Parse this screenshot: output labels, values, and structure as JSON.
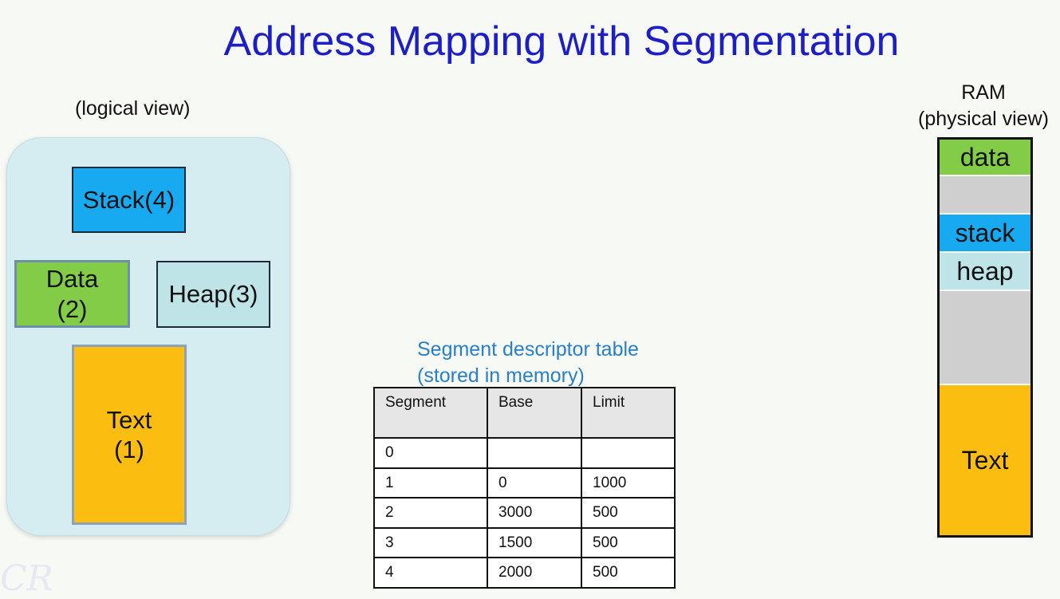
{
  "title": "Address Mapping with Segmentation",
  "logical": {
    "caption": "(logical view)",
    "segments": {
      "stack": "Stack(4)",
      "data_line1": "Data",
      "data_line2": "(2)",
      "heap": "Heap(3)",
      "text_line1": "Text",
      "text_line2": "(1)"
    }
  },
  "table": {
    "caption_line1": "Segment descriptor table",
    "caption_line2": "(stored in memory)",
    "headers": [
      "Segment",
      "Base",
      "Limit"
    ],
    "rows": [
      [
        "0",
        "",
        ""
      ],
      [
        "1",
        "0",
        "1000"
      ],
      [
        "2",
        "3000",
        "500"
      ],
      [
        "3",
        "1500",
        "500"
      ],
      [
        "4",
        "2000",
        "500"
      ]
    ]
  },
  "ram": {
    "caption_line1": "RAM",
    "caption_line2": "(physical view)",
    "blocks": [
      {
        "label": "data",
        "color": "#82cc47",
        "weight": 46
      },
      {
        "label": "",
        "color": "#cfcfcf",
        "weight": 48
      },
      {
        "label": "stack",
        "color": "#17aaf0",
        "weight": 48
      },
      {
        "label": "heap",
        "color": "#bfe4e8",
        "weight": 48
      },
      {
        "label": "",
        "color": "#cfcfcf",
        "weight": 118
      },
      {
        "label": "Text",
        "color": "#fbbd0f",
        "weight": 188
      }
    ]
  },
  "colors": {
    "title": "#1d1fc4",
    "caption_blue": "#2a7fc6",
    "stack": "#17aaf0",
    "data": "#82cc47",
    "heap": "#bfe4e8",
    "text": "#fbbd0f",
    "free": "#cfcfcf"
  },
  "watermark": "CR"
}
